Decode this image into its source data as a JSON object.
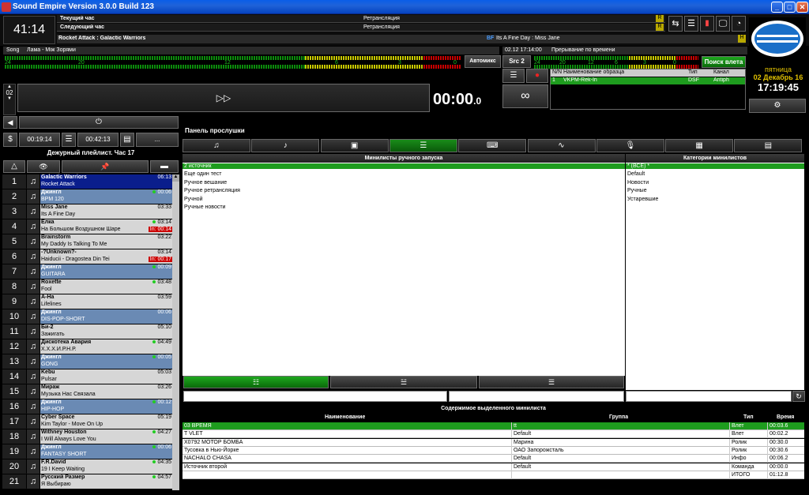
{
  "window": {
    "title": "Sound Empire Version 3.0.0 Build 123",
    "min": "_",
    "max": "□",
    "close": "✕"
  },
  "header": {
    "clock": "41:14",
    "current_hour_label": "Текущий час",
    "next_hour_label": "Следующий час",
    "current_hour_value": "Ретрансляция",
    "next_hour_value": "Ретрансляция",
    "now_playing": "Rocket Attack : Galactic Warriors",
    "bf_tag": "BF",
    "next_playing": "Its A Fine Day : Miss Jane",
    "badge_r": "R",
    "badge_h": "H"
  },
  "player1": {
    "label": "Song",
    "track": "Лама - Між Зорями",
    "automix": "Автомикс",
    "scale": [
      "24",
      "20",
      "12",
      "6",
      "3",
      "0"
    ],
    "time": "00:00",
    "time_frac": "0",
    "counter": "02",
    "play_glyph": "▷▷"
  },
  "player2": {
    "datetime": "02.12 17:14:00",
    "interrupt": "Прерывание по времени",
    "src": "Src 2",
    "search_button": "Поиск влета",
    "scale": [
      "24",
      "20",
      "12",
      "6",
      "3",
      "0"
    ],
    "columns": [
      "N/N",
      "Наименование образца",
      "Тип",
      "Канал"
    ],
    "row": {
      "n": "1",
      "name": "VKPM-Rek-In",
      "type": "DSF",
      "channel": "Antiph"
    },
    "loop_glyph": "∞"
  },
  "datebox": {
    "day": "пятница",
    "date": "02 Декабрь 16",
    "time": "17:19:45"
  },
  "playlist_panel": {
    "time1": "00:19:14",
    "time2": "00:42:13",
    "title": "Дежурный плейлист. Час 17",
    "rows": [
      {
        "n": "1",
        "artist": "Galactic Warriors",
        "song": "Rocket Attack",
        "dur": "06:13",
        "type": "sel",
        "dot": false,
        "in": ""
      },
      {
        "n": "2",
        "artist": "Джингл",
        "song": "BPM 120",
        "dur": "00:06",
        "type": "j",
        "dot": true,
        "in": ""
      },
      {
        "n": "3",
        "artist": "Miss Jane",
        "song": "Its A Fine Day",
        "dur": "03:33",
        "type": "",
        "dot": false,
        "in": ""
      },
      {
        "n": "4",
        "artist": "Ёлка",
        "song": "На Большом Воздушном Шаре",
        "dur": "03:14",
        "type": "",
        "dot": true,
        "in": "In: 00:14"
      },
      {
        "n": "5",
        "artist": "Brainstorm",
        "song": "My Daddy Is Talking To Me",
        "dur": "03:22",
        "type": "",
        "dot": false,
        "in": ""
      },
      {
        "n": "6",
        "artist": "-?Unknown?-",
        "song": "Haiducii - Dragostea Din Tei",
        "dur": "03:14",
        "type": "",
        "dot": false,
        "in": "In: 00:17"
      },
      {
        "n": "7",
        "artist": "Джингл",
        "song": "GUITARA",
        "dur": "00:09",
        "type": "j",
        "dot": true,
        "in": ""
      },
      {
        "n": "8",
        "artist": "Roxette",
        "song": "Fool",
        "dur": "03:48",
        "type": "",
        "dot": true,
        "in": ""
      },
      {
        "n": "9",
        "artist": "A-Ha",
        "song": "Lifelines",
        "dur": "03:59",
        "type": "",
        "dot": false,
        "in": ""
      },
      {
        "n": "10",
        "artist": "Джингл",
        "song": "DIS-POP-SHORT",
        "dur": "00:06",
        "type": "j",
        "dot": false,
        "in": ""
      },
      {
        "n": "11",
        "artist": "Би-2",
        "song": "Зажигать",
        "dur": "05:10",
        "type": "",
        "dot": false,
        "in": ""
      },
      {
        "n": "12",
        "artist": "Дискотека Авария",
        "song": "Х.Х.Х.И.Р.Н.Р.",
        "dur": "04:49",
        "type": "",
        "dot": true,
        "in": ""
      },
      {
        "n": "13",
        "artist": "Джингл",
        "song": "GONG",
        "dur": "00:05",
        "type": "j",
        "dot": true,
        "in": ""
      },
      {
        "n": "14",
        "artist": "Kebu",
        "song": "Pulsar",
        "dur": "05:03",
        "type": "",
        "dot": false,
        "in": ""
      },
      {
        "n": "15",
        "artist": "Мираж",
        "song": "Музыка Нас Связала",
        "dur": "03:26",
        "type": "",
        "dot": false,
        "in": ""
      },
      {
        "n": "16",
        "artist": "Джингл",
        "song": "HIP-HOP",
        "dur": "00:12",
        "type": "j",
        "dot": true,
        "in": ""
      },
      {
        "n": "17",
        "artist": "Cyber Space",
        "song": "Kim Taylor - Move On Up",
        "dur": "05:19",
        "type": "",
        "dot": false,
        "in": ""
      },
      {
        "n": "18",
        "artist": "Withney Houston",
        "song": "I Will Always Love You",
        "dur": "04:27",
        "type": "",
        "dot": true,
        "in": ""
      },
      {
        "n": "19",
        "artist": "Джингл",
        "song": "FANTASY SHORT",
        "dur": "00:06",
        "type": "j",
        "dot": true,
        "in": ""
      },
      {
        "n": "20",
        "artist": "F.R.David",
        "song": "19 I Keep Waiting",
        "dur": "04:35",
        "type": "",
        "dot": true,
        "in": ""
      },
      {
        "n": "21",
        "artist": "Русский Размер",
        "song": "Я Выбираю",
        "dur": "04:57",
        "type": "",
        "dot": true,
        "in": ""
      }
    ]
  },
  "preview_panel": {
    "title": "Панель прослушки"
  },
  "tabs": [
    "♫",
    "♪",
    "▣",
    "☰",
    "⌨",
    "∿",
    "🎙",
    "▦",
    "▤"
  ],
  "minilists": {
    "title": "Минилисты ручного запуска",
    "items": [
      "2 источник",
      "Еще один тест",
      "Ручное вешание",
      "Ручное ретрансляция",
      "Ручной",
      "Ручные новости"
    ]
  },
  "categories": {
    "title": "Категории минилистов",
    "items": [
      "* (ВСЕ) *",
      "Default",
      "Новости",
      "Ручные",
      "Устаревшие"
    ]
  },
  "contents": {
    "title": "Содержимое выделенного минилиста",
    "columns": [
      "Наименование",
      "Группа",
      "Тип",
      "Время"
    ],
    "rows": [
      {
        "name": "03 ВРЕМЯ",
        "group": "tt",
        "type": "Влет",
        "time": "00:03.6"
      },
      {
        "name": "T VLET",
        "group": "Default",
        "type": "Влет",
        "time": "00:02.2"
      },
      {
        "name": "X0792 МОТОР БОМБА",
        "group": "Марина",
        "type": "Ролик",
        "time": "00:30.0"
      },
      {
        "name": "Тусовка в Нью-Йорке",
        "group": "ОАО Запорожсталь",
        "type": "Ролик",
        "time": "00:30.6"
      },
      {
        "name": "NACHALO CHASA",
        "group": "Default",
        "type": "Инфо",
        "time": "00:06.2"
      },
      {
        "name": "Источник второй",
        "group": "Default",
        "type": "Команда",
        "time": "00:00.0"
      },
      {
        "name": "",
        "group": "",
        "type": "ИТОГО",
        "time": "01:12.8"
      }
    ]
  },
  "colors": {
    "accent_green": "#1e9c1e",
    "selection_blue": "#0a1e8c",
    "jingle_blue": "#6a8ab4",
    "titlebar": "#0a5ee8"
  }
}
